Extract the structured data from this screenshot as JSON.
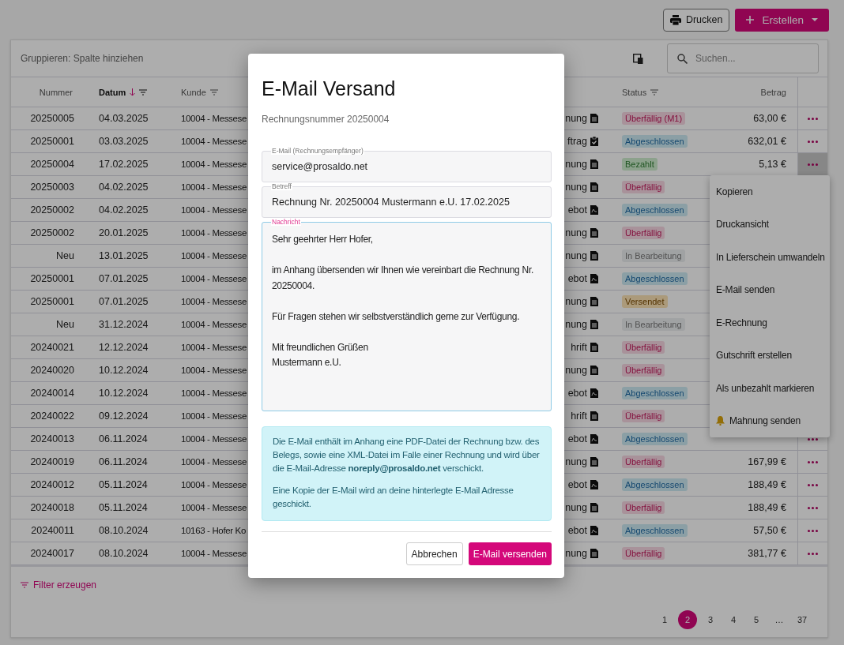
{
  "toolbar": {
    "print_button": "Drucken",
    "create_button": "Erstellen"
  },
  "table": {
    "group_hint": "Gruppieren: Spalte hinziehen",
    "search": {
      "placeholder": "Suchen..."
    },
    "columns": [
      {
        "label": "Nummer",
        "kind": "number",
        "sort_descending": false,
        "filter": false
      },
      {
        "label": "Datum",
        "kind": "date",
        "sort_descending": true,
        "filter": true
      },
      {
        "label": "Kunde",
        "kind": "customer",
        "sort_descending": false,
        "filter": true
      },
      {
        "label": "Status",
        "kind": "status",
        "sort_descending": false,
        "filter": true
      },
      {
        "label": "Betrag",
        "kind": "amount",
        "sort_descending": false,
        "filter": false
      }
    ],
    "rows": [
      {
        "number": "20250005",
        "date": "04.03.2025",
        "customer": "10004 - Messese",
        "type": {
          "text": "nung",
          "kind": "invoice"
        },
        "status": {
          "label": "Überfällig (M1)",
          "kind": "overdue"
        },
        "amount": "63,00 €",
        "actions": {
          "open": false
        }
      },
      {
        "number": "20250001",
        "date": "03.03.2025",
        "customer": "10004 - Messese",
        "type": {
          "text": "ftrag",
          "kind": "order"
        },
        "status": {
          "label": "Abgeschlossen",
          "kind": "done"
        },
        "amount": "632,01 €",
        "actions": {
          "open": false
        }
      },
      {
        "number": "20250004",
        "date": "17.02.2025",
        "customer": "10004 - Messese",
        "type": {
          "text": "nung",
          "kind": "invoice"
        },
        "status": {
          "label": "Bezahlt",
          "kind": "paid"
        },
        "amount": "5,13 €",
        "actions": {
          "open": true
        }
      },
      {
        "number": "20250003",
        "date": "04.02.2025",
        "customer": "10004 - Messese",
        "type": {
          "text": "nung",
          "kind": "invoice"
        },
        "status": {
          "label": "Überfällig",
          "kind": "overdue"
        }
      },
      {
        "number": "20250002",
        "date": "04.02.2025",
        "customer": "10004 - Messese",
        "type": {
          "text": "ebot",
          "kind": "quote"
        },
        "status": {
          "label": "Abgeschlossen",
          "kind": "done"
        }
      },
      {
        "number": "20250002",
        "date": "20.01.2025",
        "customer": "10004 - Messese",
        "type": {
          "text": "nung",
          "kind": "invoice"
        },
        "status": {
          "label": "Überfällig",
          "kind": "overdue"
        }
      },
      {
        "number": "Neu",
        "date": "13.01.2025",
        "customer": "10004 - Messese",
        "type": {
          "text": "nung",
          "kind": "invoice"
        },
        "status": {
          "label": "In Bearbeitung",
          "kind": "progress"
        }
      },
      {
        "number": "20250001",
        "date": "07.01.2025",
        "customer": "10004 - Messese",
        "type": {
          "text": "ebot",
          "kind": "quote"
        },
        "status": {
          "label": "Abgeschlossen",
          "kind": "done"
        }
      },
      {
        "number": "20250001",
        "date": "07.01.2025",
        "customer": "10004 - Messese",
        "type": {
          "text": "nung",
          "kind": "invoice"
        },
        "status": {
          "label": "Versendet",
          "kind": "sent"
        }
      },
      {
        "number": "Neu",
        "date": "31.12.2024",
        "customer": "10004 - Messese",
        "type": {
          "text": "nung",
          "kind": "invoice"
        },
        "status": {
          "label": "In Bearbeitung",
          "kind": "progress"
        }
      },
      {
        "number": "20240021",
        "date": "12.12.2024",
        "customer": "10004 - Messese",
        "type": {
          "text": "hrift",
          "kind": "invoice"
        },
        "status": {
          "label": "Überfällig",
          "kind": "overdue"
        }
      },
      {
        "number": "20240020",
        "date": "10.12.2024",
        "customer": "10004 - Messese",
        "type": {
          "text": "nung",
          "kind": "invoice"
        },
        "status": {
          "label": "Überfällig",
          "kind": "overdue"
        }
      },
      {
        "number": "20240014",
        "date": "10.12.2024",
        "customer": "10004 - Messese",
        "type": {
          "text": "ebot",
          "kind": "quote"
        },
        "status": {
          "label": "Abgeschlossen",
          "kind": "done"
        }
      },
      {
        "number": "20240022",
        "date": "09.12.2024",
        "customer": "10004 - Messese",
        "type": {
          "text": "hrift",
          "kind": "invoice"
        },
        "status": {
          "label": "Überfällig",
          "kind": "overdue"
        }
      },
      {
        "number": "20240013",
        "date": "06.11.2024",
        "customer": "10004 - Messese",
        "type": {
          "text": "ebot",
          "kind": "quote"
        },
        "status": {
          "label": "Abgeschlossen",
          "kind": "done"
        },
        "actions": {
          "open": false
        }
      },
      {
        "number": "20240019",
        "date": "06.11.2024",
        "customer": "10004 - Messese",
        "type": {
          "text": "nung",
          "kind": "invoice"
        },
        "status": {
          "label": "Überfällig",
          "kind": "overdue"
        },
        "amount": "167,99 €",
        "actions": {
          "open": false
        }
      },
      {
        "number": "20240012",
        "date": "05.11.2024",
        "customer": "10004 - Messese",
        "type": {
          "text": "ebot",
          "kind": "quote"
        },
        "status": {
          "label": "Abgeschlossen",
          "kind": "done"
        },
        "amount": "188,49 €",
        "actions": {
          "open": false
        }
      },
      {
        "number": "20240018",
        "date": "05.11.2024",
        "customer": "10004 - Messese",
        "type": {
          "text": "nung",
          "kind": "invoice"
        },
        "status": {
          "label": "Überfällig",
          "kind": "overdue"
        },
        "amount": "188,49 €",
        "actions": {
          "open": false
        }
      },
      {
        "number": "20240011",
        "date": "08.10.2024",
        "customer": "10163 - Hofer Ko",
        "type": {
          "text": "ebot",
          "kind": "quote"
        },
        "status": {
          "label": "Abgeschlossen",
          "kind": "done"
        },
        "amount": "57,50 €",
        "actions": {
          "open": false
        }
      },
      {
        "number": "20240017",
        "date": "08.10.2024",
        "customer": "10004 - Messese",
        "type": {
          "text": "nung",
          "kind": "invoice"
        },
        "status": {
          "label": "Überfällig",
          "kind": "overdue"
        },
        "amount": "381,77 €",
        "actions": {
          "open": false
        }
      }
    ],
    "filter_link": "Filter erzeugen",
    "pages": [
      {
        "label": "1",
        "selected": false
      },
      {
        "label": "2",
        "selected": true
      },
      {
        "label": "3",
        "selected": false
      },
      {
        "label": "4",
        "selected": false
      },
      {
        "label": "5",
        "selected": false
      },
      {
        "label": "…",
        "selected": false
      },
      {
        "label": "37",
        "selected": false
      }
    ]
  },
  "context_menu": {
    "items": [
      {
        "label": "Kopieren",
        "kind": "plain"
      },
      {
        "label": "Druckansicht",
        "kind": "plain"
      },
      {
        "label": "In Lieferschein umwandeln",
        "kind": "plain"
      },
      {
        "label": "E-Mail senden",
        "kind": "plain"
      },
      {
        "label": "E-Rechnung",
        "kind": "plain"
      },
      {
        "label": "Gutschrift erstellen",
        "kind": "plain"
      },
      {
        "label": "Als unbezahlt markieren",
        "kind": "plain"
      },
      {
        "label": "Mahnung senden",
        "kind": "bell"
      }
    ]
  },
  "dialog": {
    "title": "E-Mail Versand",
    "subtitle": "Rechnungsnummer 20250004",
    "fields": [
      {
        "label": "E-Mail (Rechnungsempfänger)",
        "value": "service@prosaldo.net",
        "focused": false
      },
      {
        "label": "Betreff",
        "value": "Rechnung Nr. 20250004 Mustermann e.U. 17.02.2025",
        "focused": false
      }
    ],
    "message": {
      "label": "Nachricht",
      "value": "Sehr geehrter Herr Hofer,\n\nim Anhang übersenden wir Ihnen wie vereinbart die Rechnung Nr. 20250004.\n\nFür Fragen stehen wir selbstverständlich gerne zur Verfügung.\n\nMit freundlichen Grüßen\nMustermann e.U.",
      "focused": true
    },
    "info": [
      "Die E-Mail enthält im Anhang eine PDF-Datei der Rechnung bzw. des Belegs, sowie eine XML-Datei im Falle einer Rechnung und wird über die E-Mail-Adresse **noreply@prosaldo.net** verschickt.",
      "Eine Kopie der E-Mail wird an deine hinterlegte E-Mail Adresse geschickt."
    ],
    "cancel_button": "Abbrechen",
    "send_button": "E-Mail versenden"
  }
}
